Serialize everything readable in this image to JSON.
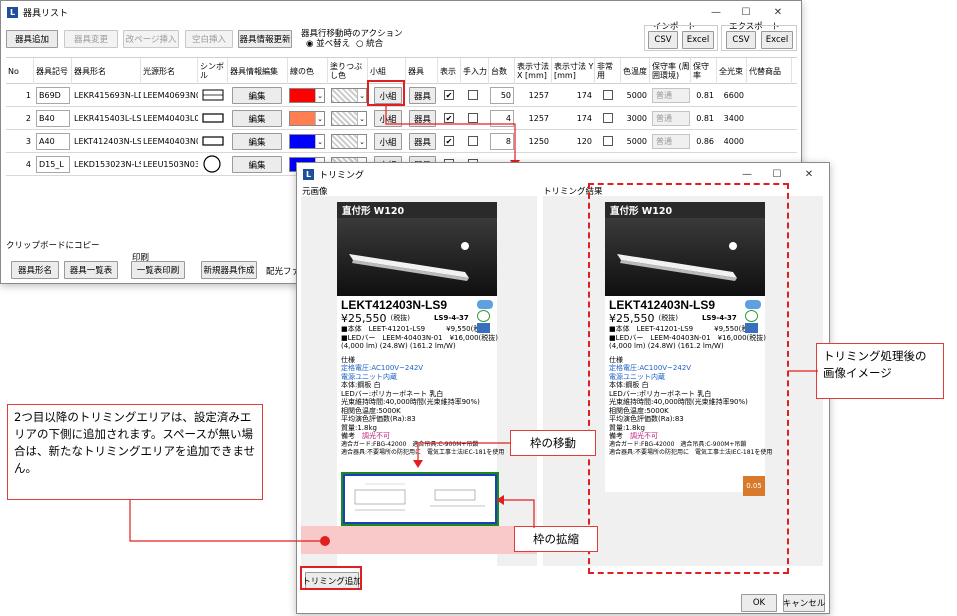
{
  "main_window": {
    "title": "器具リスト",
    "toolbar": {
      "add": "器具追加",
      "change": "器具変更",
      "page_break": "改ページ挿入",
      "blank": "空白挿入",
      "info_update": "器具情報更新",
      "action_title": "器具行移動時のアクション",
      "radio_sort": "並べ替え",
      "radio_merge": "統合",
      "import_label": "インポート",
      "export_label": "エクスポート",
      "csv": "CSV",
      "excel": "Excel"
    },
    "columns": [
      "No",
      "器具記号",
      "器具形名",
      "光源形名",
      "シンボル",
      "器具情報編集",
      "線の色",
      "塗りつぶし色",
      "小組",
      "器具",
      "表示",
      "手入力",
      "台数",
      "表示寸法 X [mm]",
      "表示寸法 Y [mm]",
      "非常用",
      "色温度",
      "保守率 (周囲環境)",
      "保守率",
      "全光束",
      "代替商品"
    ],
    "rows": [
      {
        "no": "1",
        "symbol_code": "B69D",
        "model": "LEKR415693N-LD9",
        "lamp": "LEEM40693N01",
        "symbol": "rect-double",
        "edit": "編集",
        "line_color": "#ff0000",
        "mini": "小組",
        "fixture": "器具",
        "show": "✔",
        "qty": "50",
        "x": "1257",
        "y": "174",
        "temp": "5000",
        "maint": "普通",
        "maint_rate": "0.81",
        "lumen": "6600"
      },
      {
        "no": "2",
        "symbol_code": "B40",
        "model": "LEKR415403L-LS9",
        "lamp": "LEEM40403L01",
        "symbol": "rect",
        "edit": "編集",
        "line_color": "#ff7f50",
        "mini": "小組",
        "fixture": "器具",
        "show": "✔",
        "qty": "4",
        "x": "1257",
        "y": "174",
        "temp": "3000",
        "maint": "普通",
        "maint_rate": "0.81",
        "lumen": "3400"
      },
      {
        "no": "3",
        "symbol_code": "A40",
        "model": "LEKT412403N-LS9",
        "lamp": "LEEM40403N01",
        "symbol": "rect",
        "edit": "編集",
        "line_color": "#0000ff",
        "mini": "小組",
        "fixture": "器具",
        "show": "✔",
        "qty": "8",
        "x": "1250",
        "y": "120",
        "temp": "5000",
        "maint": "普通",
        "maint_rate": "0.86",
        "lumen": "4000"
      },
      {
        "no": "4",
        "symbol_code": "D15_L",
        "model": "LEKD153023N-LS9",
        "lamp": "LEEU1503N03",
        "symbol": "circle",
        "edit": "編集",
        "line_color": "#0000ff",
        "mini": "小組",
        "fixture": "器具",
        "show": "",
        "qty": "",
        "x": "",
        "y": "",
        "temp": "",
        "maint": "",
        "maint_rate": "",
        "lumen": ""
      }
    ],
    "bottom": {
      "clipboard_label": "クリップボードにコピー",
      "print_label": "印刷",
      "model_btn": "器具形名",
      "list_btn": "器具一覧表",
      "list_print_btn": "一覧表印刷",
      "new_btn": "新規器具作成",
      "layout_label": "配光ファイ"
    }
  },
  "trim_window": {
    "title": "トリミング",
    "original_label": "元画像",
    "result_label": "トリミング結果",
    "add_button": "トリミング追加",
    "ok": "OK",
    "cancel": "キャンセル"
  },
  "product": {
    "band": "直付形 W120",
    "code": "LEKT412403N-LS9",
    "price": "¥25,550",
    "price_note": "(税抜)",
    "series": "LS9-4-37",
    "lines": [
      "■本体　LEET-41201-LS9　　　¥9,550(税抜)",
      "■LEDバー　LEEM-40403N-01　¥16,000(税抜)",
      "(4,000 lm) (24.8W) (161.2 lm/W)"
    ],
    "spec_title": "仕様",
    "spec_blue": [
      "定格電圧:AC100V~242V",
      "電源ユニット内蔵"
    ],
    "spec": [
      "本体:鋼板 白",
      "LEDバー:ポリカーボネート 乳白",
      "光束維持時間:40,000時間(光束維持率90%)",
      "相関色温度:5000K",
      "平均演色評価数(Ra):83",
      "質量:1.8kg"
    ],
    "note_label": "備考",
    "note_value": "調光不可",
    "guide": "適合ガード:FBG-42000　適合吊具:C-900M+吊鎖",
    "guide2": "適合器具:不要場所の防犯用に　電気工事士法IEC-181を使用"
  },
  "callouts": {
    "left": "2つ目以降のトリミングエリアは、設定済みエリアの下側に追加されます。スペースが無い場合は、新たなトリミングエリアを追加できません。",
    "move": "枠の移動",
    "resize": "枠の拡縮",
    "result": "トリミング処理後の画像イメージ"
  },
  "colors": {
    "accent_red": "#e03c3c",
    "trim_frame": "#1a8a1a",
    "trim_inner": "#1c3fbf",
    "pink_area": "#f9c9c9",
    "dark_band": "#2a2a2a"
  }
}
